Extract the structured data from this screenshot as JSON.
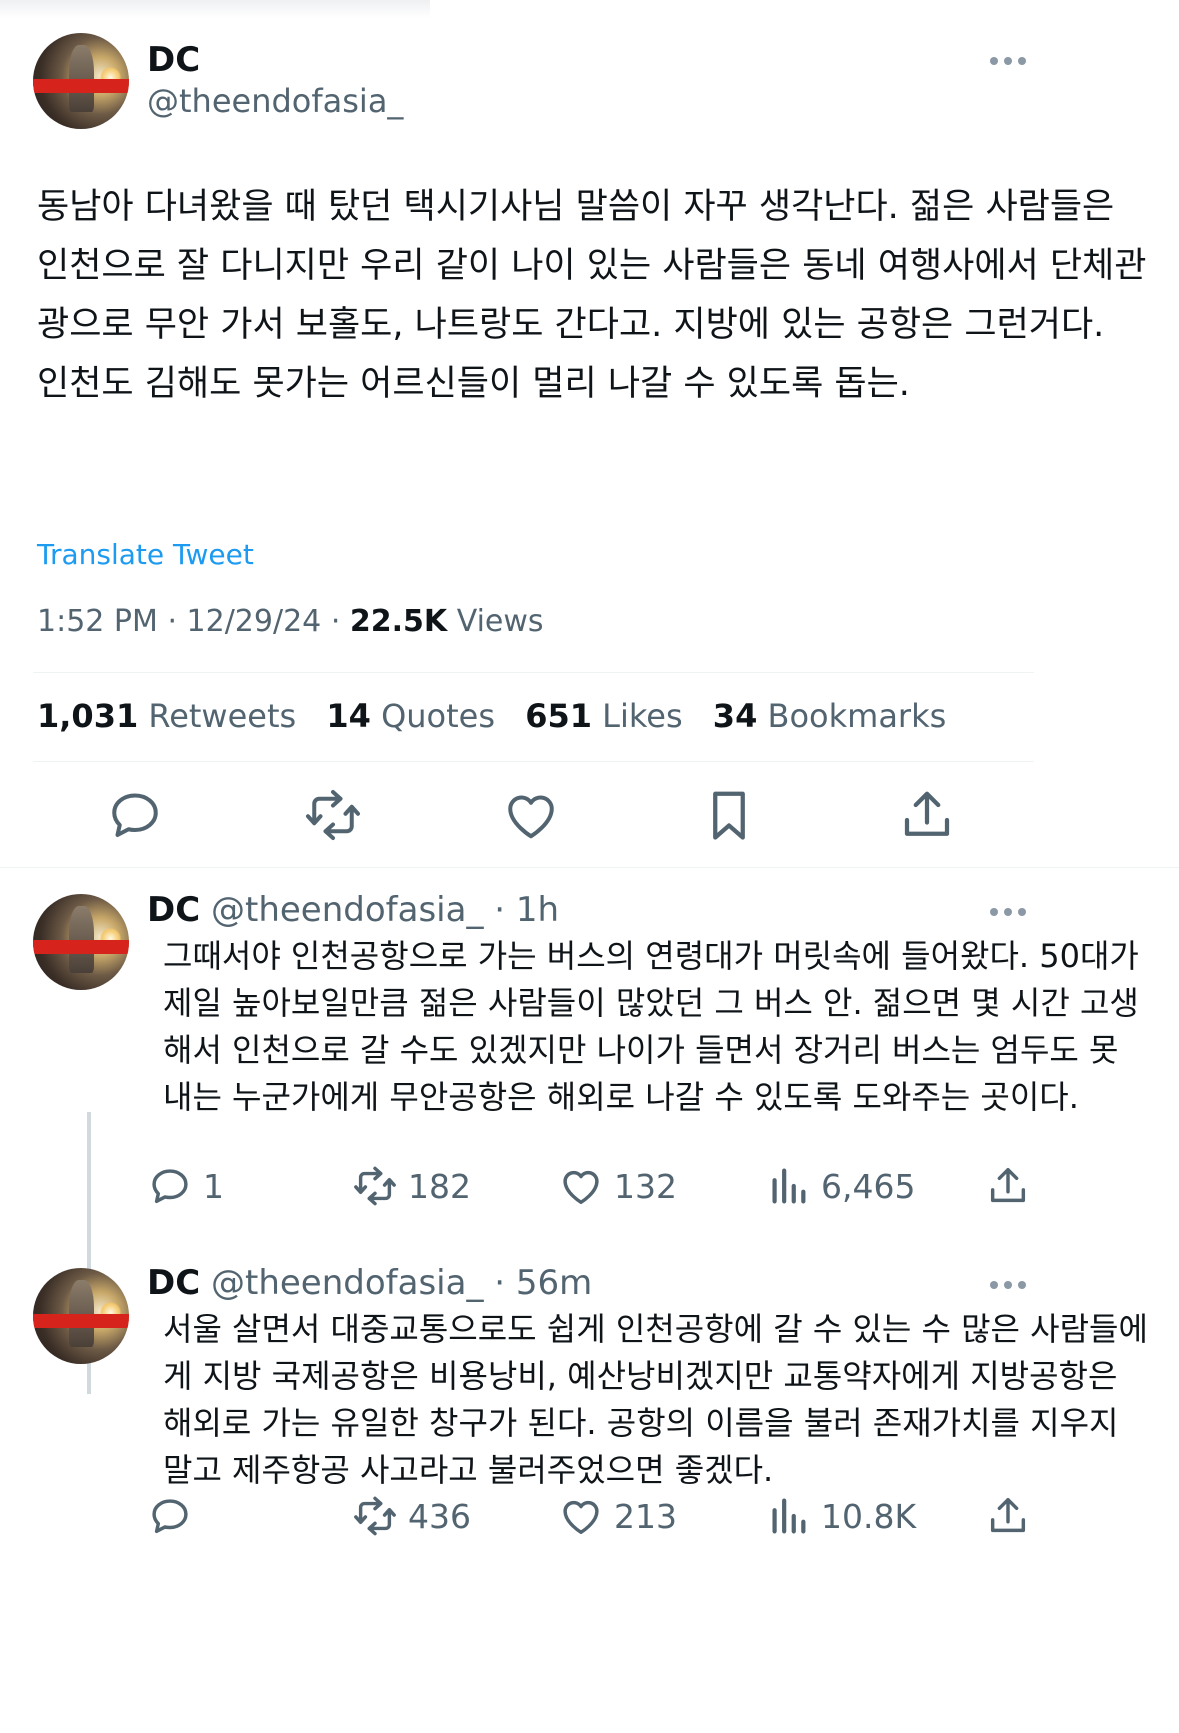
{
  "main_tweet": {
    "name": "DC",
    "handle": "@theendofasia_",
    "text": "동남아 다녀왔을 때 탔던 택시기사님 말씀이 자꾸 생각난다. 젊은 사람들은 인천으로 잘 다니지만 우리 같이 나이 있는 사람들은 동네 여행사에서 단체관광으로 무안 가서 보홀도, 나트랑도 간다고. 지방에 있는 공항은 그런거다. 인천도 김해도 못가는 어르신들이 멀리 나갈 수 있도록 돕는.",
    "translate_label": "Translate Tweet",
    "time": "1:52 PM",
    "date": "12/29/24",
    "views_count": "22.5K",
    "views_label": "Views",
    "stats": {
      "retweets_count": "1,031",
      "retweets_label": "Retweets",
      "quotes_count": "14",
      "quotes_label": "Quotes",
      "likes_count": "651",
      "likes_label": "Likes",
      "bookmarks_count": "34",
      "bookmarks_label": "Bookmarks"
    }
  },
  "replies": [
    {
      "name": "DC",
      "handle": "@theendofasia_",
      "time": "· 1h",
      "text": "그때서야 인천공항으로 가는 버스의 연령대가 머릿속에 들어왔다. 50대가 제일 높아보일만큼 젊은 사람들이 많았던 그 버스 안. 젊으면 몇 시간 고생해서 인천으로 갈 수도 있겠지만 나이가 들면서 장거리 버스는 엄두도 못 내는 누군가에게 무안공항은 해외로 나갈 수 있도록 도와주는 곳이다.",
      "replies": "1",
      "retweets": "182",
      "likes": "132",
      "views": "6,465"
    },
    {
      "name": "DC",
      "handle": "@theendofasia_",
      "time": "· 56m",
      "text": "서울 살면서 대중교통으로도 쉽게 인천공항에 갈 수 있는 수 많은 사람들에게 지방 국제공항은 비용낭비, 예산낭비겠지만 교통약자에게 지방공항은 해외로 가는 유일한 창구가 된다. 공항의 이름을 불러 존재가치를 지우지 말고 제주항공 사고라고 불러주었으면 좋겠다.",
      "replies": "",
      "retweets": "436",
      "likes": "213",
      "views": "10.8K"
    }
  ],
  "icons": {
    "reply": "speech-bubble-icon",
    "retweet": "retweet-arrows-icon",
    "like": "heart-icon",
    "bookmark": "bookmark-icon",
    "share": "share-upload-icon",
    "views": "bar-chart-icon",
    "more": "more-dots-icon"
  },
  "colors": {
    "link": "#1d9bf0",
    "muted": "#536471",
    "text": "#0f1419",
    "divider": "#eff3f4"
  }
}
